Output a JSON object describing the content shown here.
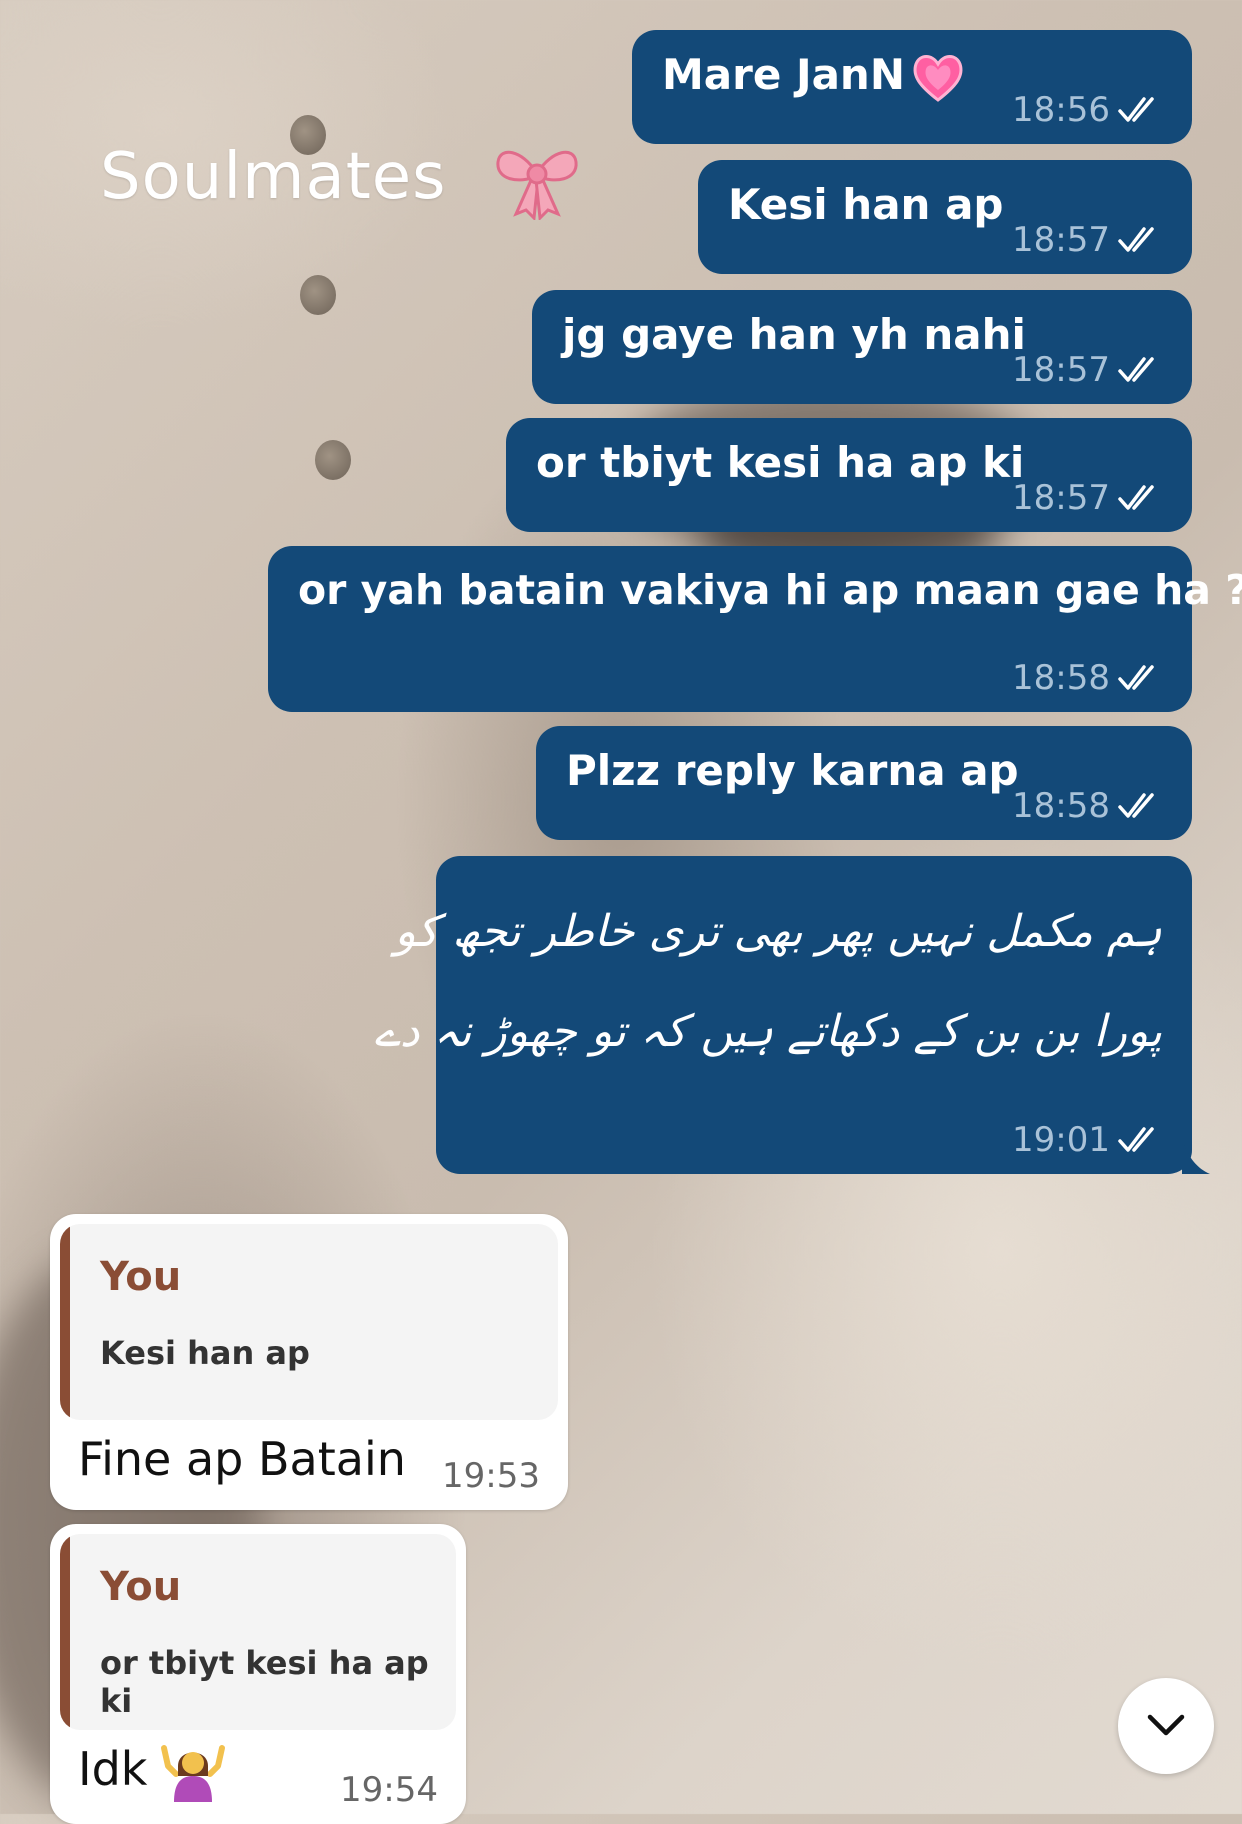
{
  "wallpaper": {
    "caption": "Soulmates",
    "caption_icon": "ribbon-bow-icon"
  },
  "colors": {
    "outgoing_bubble": "#134978",
    "incoming_bubble": "#ffffff",
    "quote_accent": "#8a4d35"
  },
  "messages_out": [
    {
      "text": "Mare JanN",
      "emoji": "growing-heart-icon",
      "time": "18:56",
      "status": "read"
    },
    {
      "text": "Kesi han ap",
      "time": "18:57",
      "status": "read"
    },
    {
      "text": "jg gaye han yh nahi",
      "time": "18:57",
      "status": "read"
    },
    {
      "text": "or tbiyt kesi ha ap ki",
      "time": "18:57",
      "status": "read"
    },
    {
      "text": "or yah batain vakiya hi ap maan gae ha ?",
      "time": "18:58",
      "status": "read"
    },
    {
      "text": "Plzz reply karna ap",
      "time": "18:58",
      "status": "read"
    },
    {
      "poem_line1": "ہم مکمل نہیں پھر بھی تری خاطر تجھ کو",
      "poem_line2": "پورا بن بن کے دکھاتے ہیں کہ تو چھوڑ نہ دے",
      "time": "19:01",
      "status": "read"
    }
  ],
  "messages_in": [
    {
      "quote_author": "You",
      "quote_text": "Kesi han ap",
      "text": "Fine ap Batain",
      "time": "19:53"
    },
    {
      "quote_author": "You",
      "quote_text": "or tbiyt kesi ha ap ki",
      "text": "Idk",
      "emoji": "person-shrugging-icon",
      "time": "19:54"
    }
  ],
  "scroll_button_icon": "chevron-down-icon"
}
